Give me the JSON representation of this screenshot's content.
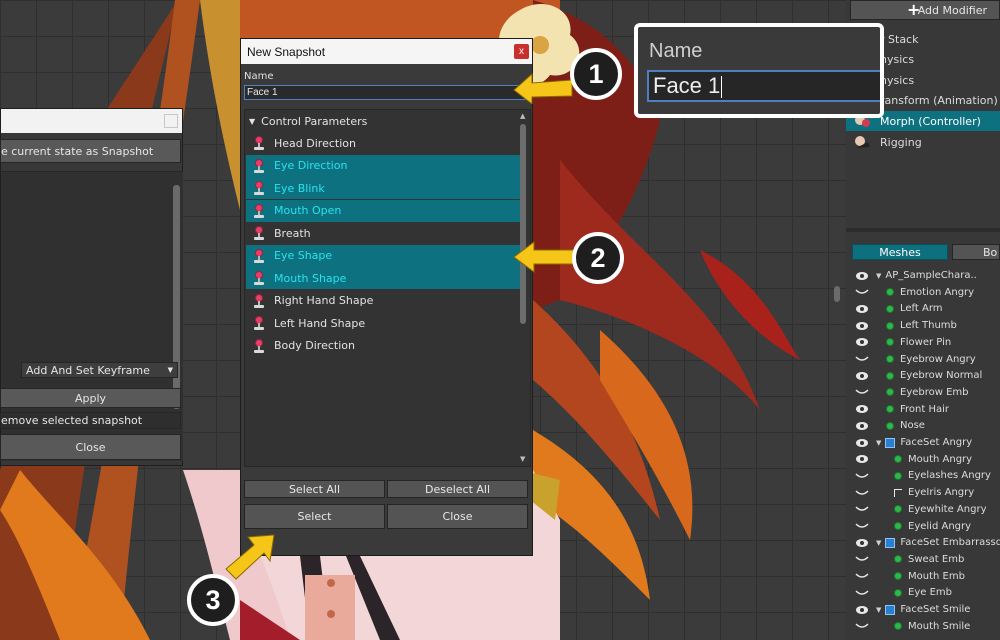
{
  "left_dialog": {
    "save_label": "e current state as Snapshot",
    "keyframe_select": "Add And Set Keyframe",
    "apply_label": "Apply",
    "remove_label": "emove selected snapshot",
    "close_label": "Close"
  },
  "snapshot_dialog": {
    "title": "New Snapshot",
    "close_glyph": "x",
    "name_label": "Name",
    "name_value": "Face 1",
    "group_header": "Control Parameters",
    "params": [
      {
        "label": "Head Direction",
        "selected": false
      },
      {
        "label": "Eye Direction",
        "selected": true
      },
      {
        "label": "Eye Blink",
        "selected": true
      },
      {
        "label": "Mouth Open",
        "selected": true
      },
      {
        "label": "Breath",
        "selected": false
      },
      {
        "label": "Eye Shape",
        "selected": true
      },
      {
        "label": "Mouth Shape",
        "selected": true
      },
      {
        "label": "Right Hand Shape",
        "selected": false
      },
      {
        "label": "Left Hand Shape",
        "selected": false
      },
      {
        "label": "Body Direction",
        "selected": false
      }
    ],
    "select_all_label": "Select All",
    "deselect_all_label": "Deselect All",
    "select_label": "Select",
    "close_label": "Close"
  },
  "callout": {
    "label": "Name",
    "value": "Face 1"
  },
  "badges": {
    "one": "1",
    "two": "2",
    "three": "3"
  },
  "right_panel": {
    "add_modifier_label": "Add Modifier",
    "modifiers": [
      {
        "label": "r Stack",
        "icon": "stack-icon",
        "selected": false
      },
      {
        "label": "hysics",
        "icon": "physics-icon",
        "selected": false
      },
      {
        "label": "hysics",
        "icon": "physics-icon",
        "selected": false
      },
      {
        "label": "ransform (Animation)",
        "icon": "transform-icon",
        "selected": false
      },
      {
        "label": "Morph (Controller)",
        "icon": "morph-icon",
        "selected": true
      },
      {
        "label": "Rigging",
        "icon": "rigging-icon",
        "selected": false
      }
    ],
    "tabs": {
      "meshes": "Meshes",
      "bones": "Bo"
    },
    "tree": [
      {
        "label": "AP_SampleChara..",
        "kind": "root",
        "indent": 0,
        "vis": "eye"
      },
      {
        "label": "Emotion Angry",
        "kind": "mesh",
        "indent": 1,
        "vis": "closed"
      },
      {
        "label": "Left Arm",
        "kind": "mesh",
        "indent": 1,
        "vis": "eye"
      },
      {
        "label": "Left Thumb",
        "kind": "mesh",
        "indent": 1,
        "vis": "eye"
      },
      {
        "label": "Flower Pin",
        "kind": "mesh",
        "indent": 1,
        "vis": "eye"
      },
      {
        "label": "Eyebrow Angry",
        "kind": "mesh",
        "indent": 1,
        "vis": "closed"
      },
      {
        "label": "Eyebrow Normal",
        "kind": "mesh",
        "indent": 1,
        "vis": "eye"
      },
      {
        "label": "Eyebrow Emb",
        "kind": "mesh",
        "indent": 1,
        "vis": "closed"
      },
      {
        "label": "Front Hair",
        "kind": "mesh",
        "indent": 1,
        "vis": "eye"
      },
      {
        "label": "Nose",
        "kind": "mesh",
        "indent": 1,
        "vis": "eye"
      },
      {
        "label": "FaceSet Angry",
        "kind": "group",
        "indent": 0,
        "vis": "eye"
      },
      {
        "label": "Mouth Angry",
        "kind": "mesh",
        "indent": 2,
        "vis": "eye"
      },
      {
        "label": "Eyelashes Angry",
        "kind": "mesh",
        "indent": 2,
        "vis": "closed"
      },
      {
        "label": "EyeIris Angry",
        "kind": "bone",
        "indent": 2,
        "vis": "closed"
      },
      {
        "label": "Eyewhite Angry",
        "kind": "mesh",
        "indent": 2,
        "vis": "closed"
      },
      {
        "label": "Eyelid Angry",
        "kind": "mesh",
        "indent": 2,
        "vis": "closed"
      },
      {
        "label": "FaceSet Embarrassd",
        "kind": "group",
        "indent": 0,
        "vis": "eye"
      },
      {
        "label": "Sweat Emb",
        "kind": "mesh",
        "indent": 2,
        "vis": "closed"
      },
      {
        "label": "Mouth Emb",
        "kind": "mesh",
        "indent": 2,
        "vis": "closed"
      },
      {
        "label": "Eye Emb",
        "kind": "mesh",
        "indent": 2,
        "vis": "closed"
      },
      {
        "label": "FaceSet Smile",
        "kind": "group",
        "indent": 0,
        "vis": "eye"
      },
      {
        "label": "Mouth Smile",
        "kind": "mesh",
        "indent": 2,
        "vis": "closed"
      }
    ]
  },
  "colors": {
    "selection_bg": "#0e7180",
    "selection_text": "#26e3ee",
    "arrow": "#f5c518",
    "close_red": "#c9302c"
  }
}
